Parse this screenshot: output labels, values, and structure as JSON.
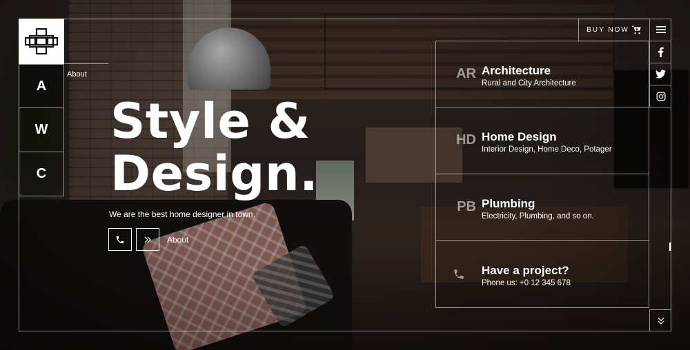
{
  "brand": {
    "logo_icon": "grid-cross-logo"
  },
  "side_nav": [
    {
      "label": "A"
    },
    {
      "label": "W"
    },
    {
      "label": "C"
    }
  ],
  "about_link": "About",
  "hero": {
    "title_line1": "Style &",
    "title_line2": "Design.",
    "subtitle": "We are the best home designer in town.",
    "phone_icon": "phone-icon",
    "next_icon": "double-chevron-right-icon",
    "about_label": "About"
  },
  "header": {
    "buy_now_label": "BUY NOW",
    "cart_icon": "cart-icon",
    "menu_icon": "hamburger-icon"
  },
  "social": [
    {
      "icon": "facebook-icon"
    },
    {
      "icon": "twitter-icon"
    },
    {
      "icon": "instagram-icon"
    }
  ],
  "services": [
    {
      "abbr": "AR",
      "name": "Architecture",
      "desc": "Rural and City Architecture"
    },
    {
      "abbr": "HD",
      "name": "Home Design",
      "desc": "Interior Design, Home Deco, Potager"
    },
    {
      "abbr": "PB",
      "name": "Plumbing",
      "desc": "Electricity, Plumbing, and so on."
    }
  ],
  "project": {
    "icon": "phone-icon",
    "title": "Have a project?",
    "phone": "Phone us: +0 12 345 678"
  },
  "scroll_icon": "double-chevron-down-icon",
  "colors": {
    "frame_line": "#ffffff",
    "text": "#ffffff",
    "abbr": "#9a9a9a"
  }
}
